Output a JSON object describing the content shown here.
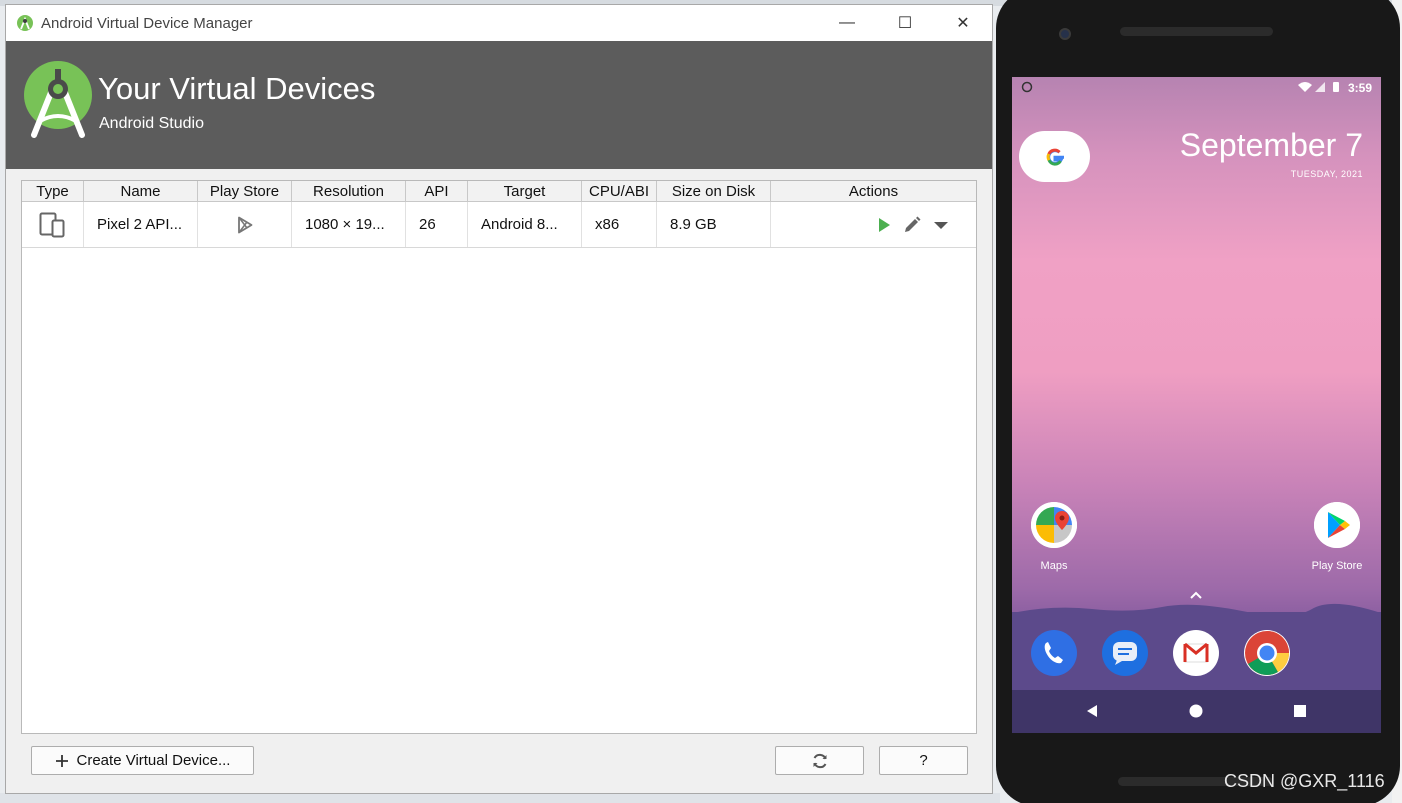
{
  "window": {
    "title": "Android Virtual Device Manager",
    "minimize": "—",
    "maximize": "☐",
    "close": "✕"
  },
  "banner": {
    "heading": "Your Virtual Devices",
    "subheading": "Android Studio"
  },
  "table": {
    "headers": [
      "Type",
      "Name",
      "Play Store",
      "Resolution",
      "API",
      "Target",
      "CPU/ABI",
      "Size on Disk",
      "Actions"
    ],
    "rows": [
      {
        "type_icon": "phone-tablet-icon",
        "name": "Pixel 2 API...",
        "play_store_icon": "play-store-icon",
        "resolution": "1080 × 19...",
        "api": "26",
        "target": "Android 8...",
        "cpu_abi": "x86",
        "size_on_disk": "8.9 GB"
      }
    ]
  },
  "footer": {
    "create_label": "Create Virtual Device...",
    "help_label": "?"
  },
  "emulator": {
    "time": "3:59",
    "date_big": "September 7",
    "date_small": "TUESDAY, 2021",
    "apps": [
      {
        "label": "Maps"
      },
      {
        "label": "Play Store"
      }
    ]
  },
  "watermark": "CSDN @GXR_1116",
  "colors": {
    "banner_bg": "#5c5c5c",
    "android_green": "#78c257",
    "play_green": "#4caf50"
  }
}
